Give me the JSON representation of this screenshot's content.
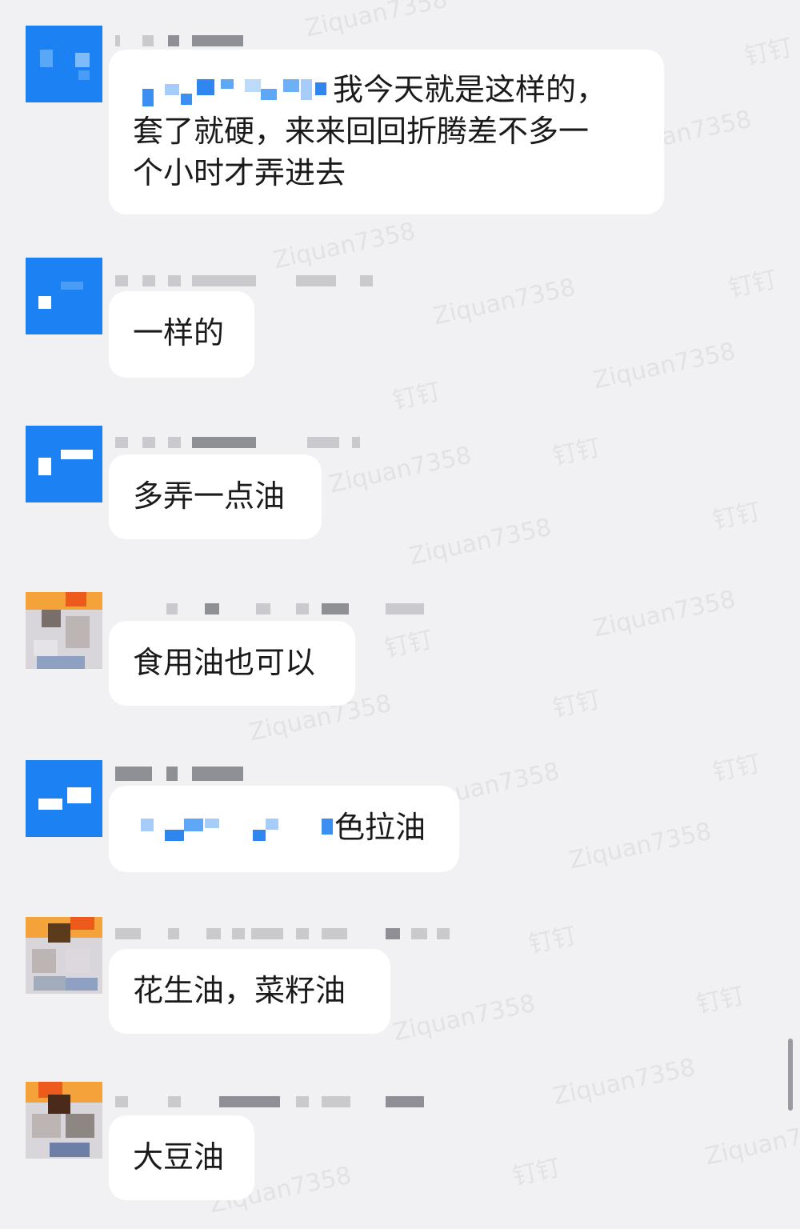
{
  "watermark": {
    "text": "Ziquan7358",
    "text_alt": "钉钉"
  },
  "messages": [
    {
      "id": "m1",
      "avatar": "blue",
      "text_visible": "我今天就是这样的，套了就硬，来来回回折腾差不多一个小时才弄进去",
      "line1_tail": "我今天就是这样的，",
      "line2": "套了就硬，来来回回折腾差不多一",
      "line3": "个小时才弄进去"
    },
    {
      "id": "m2",
      "avatar": "blue",
      "text": "一样的"
    },
    {
      "id": "m3",
      "avatar": "blue",
      "text": "多弄一点油"
    },
    {
      "id": "m4",
      "avatar": "photo",
      "text": "食用油也可以"
    },
    {
      "id": "m5",
      "avatar": "blue",
      "text_tail": "色拉油"
    },
    {
      "id": "m6",
      "avatar": "photo",
      "text": "花生油，菜籽油"
    },
    {
      "id": "m7",
      "avatar": "photo",
      "text": "大豆油"
    }
  ]
}
